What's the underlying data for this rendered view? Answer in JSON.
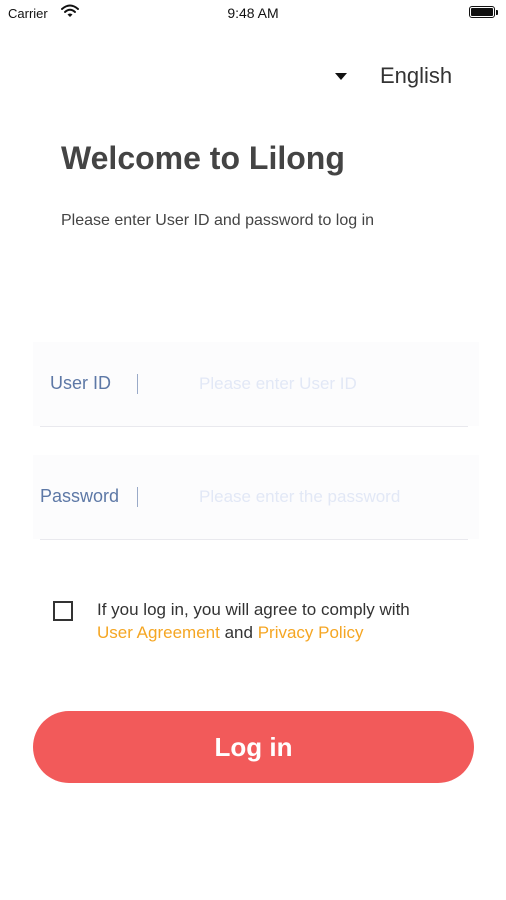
{
  "status_bar": {
    "carrier": "Carrier",
    "time": "9:48 AM"
  },
  "language": {
    "label": "English"
  },
  "header": {
    "title": "Welcome to Lilong",
    "subtitle": "Please enter User ID and password to log in"
  },
  "form": {
    "user_id": {
      "label": "User ID",
      "placeholder": "Please enter User ID",
      "value": ""
    },
    "password": {
      "label": "Password",
      "placeholder": "Please enter the password",
      "value": ""
    }
  },
  "agreement": {
    "checked": false,
    "text_before": "If you log in, you will agree to comply with",
    "user_agreement": "User Agreement",
    "and": "and",
    "privacy_policy": "Privacy Policy"
  },
  "login_button": {
    "label": "Log in"
  },
  "colors": {
    "accent": "#f25a5a",
    "link": "#f5a623",
    "field_label": "#5d78a6"
  }
}
